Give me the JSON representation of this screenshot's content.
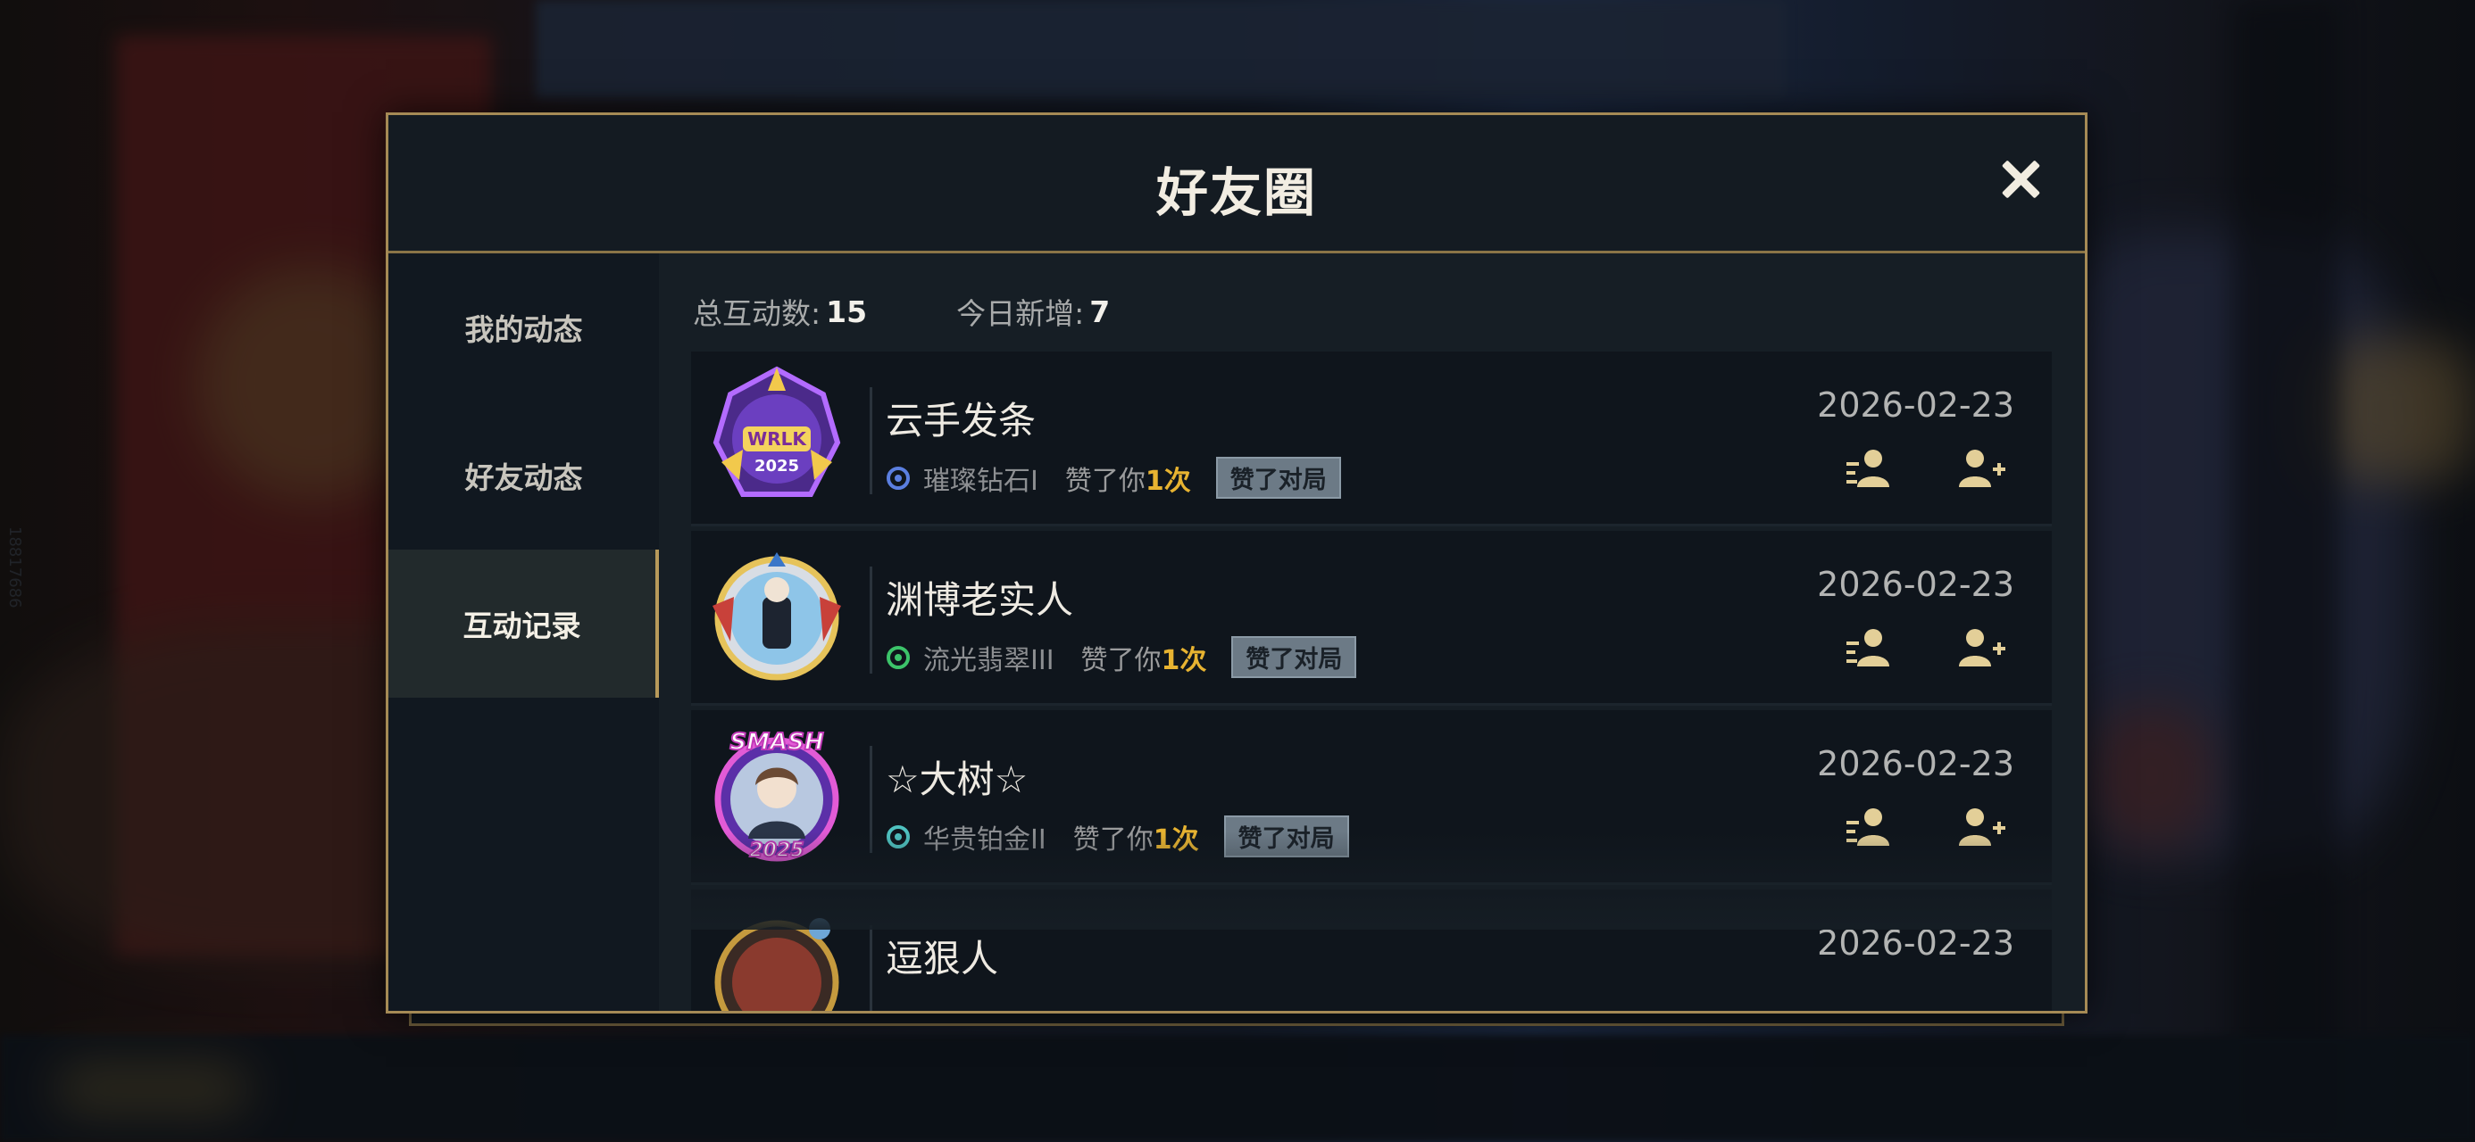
{
  "background": {
    "side_text": "18817686"
  },
  "dialog": {
    "title": "好友圈"
  },
  "sidebar": {
    "tabs": [
      {
        "label": "我的动态",
        "active": false
      },
      {
        "label": "好友动态",
        "active": false
      },
      {
        "label": "互动记录",
        "active": true
      }
    ]
  },
  "stats": {
    "total_label": "总互动数:",
    "total_value": "15",
    "today_label": "今日新增:",
    "today_value": "7"
  },
  "records": [
    {
      "name": "云手发条",
      "rank": "璀璨钻石I",
      "rank_color": "#5b7fe0",
      "action": "赞了你",
      "count": "1次",
      "tag": "赞了对局",
      "date": "2026-02-23",
      "avatar_icon": "wrlk-2025-frame-avatar"
    },
    {
      "name": "渊博老实人",
      "rank": "流光翡翠III",
      "rank_color": "#3cc46a",
      "action": "赞了你",
      "count": "1次",
      "tag": "赞了对局",
      "date": "2026-02-23",
      "avatar_icon": "frame-avatar"
    },
    {
      "name": "☆大树☆",
      "rank": "华贵铂金II",
      "rank_color": "#4fc2c0",
      "action": "赞了你",
      "count": "1次",
      "tag": "赞了对局",
      "date": "2026-02-23",
      "avatar_icon": "smash-2025-frame-avatar"
    },
    {
      "name": "逗狠人",
      "date": "2026-02-23",
      "avatar_icon": "frame-avatar"
    }
  ],
  "icons": {
    "view_profile": "profile-list-icon",
    "add_friend": "add-friend-icon",
    "close": "close-icon"
  },
  "colors": {
    "accent_gold": "#a58a55",
    "count_gold": "#e7b331"
  }
}
